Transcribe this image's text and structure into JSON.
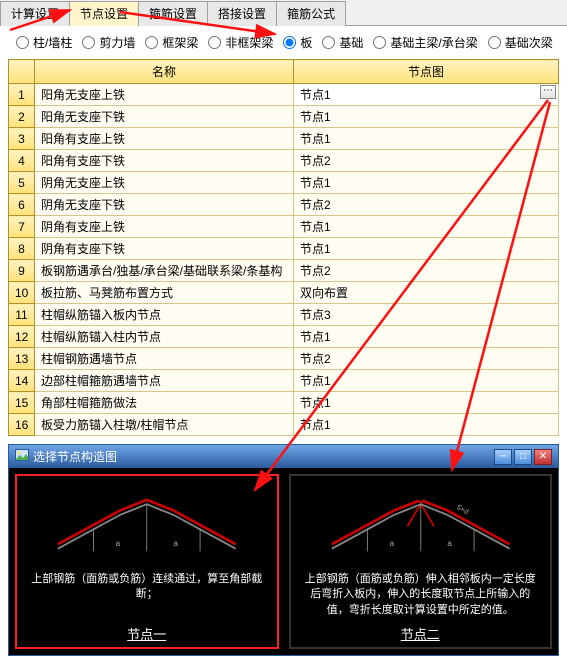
{
  "tabs": {
    "items": [
      "计算设置",
      "节点设置",
      "箍筋设置",
      "搭接设置",
      "箍筋公式"
    ],
    "active_index": 1
  },
  "radios": {
    "items": [
      "柱/墙柱",
      "剪力墙",
      "框架梁",
      "非框架梁",
      "板",
      "基础",
      "基础主梁/承台梁",
      "基础次梁"
    ],
    "selected_index": 4
  },
  "grid": {
    "headers": [
      "名称",
      "节点图"
    ],
    "rows": [
      {
        "n": "1",
        "name": "阳角无支座上铁",
        "val": "节点1"
      },
      {
        "n": "2",
        "name": "阳角无支座下铁",
        "val": "节点1"
      },
      {
        "n": "3",
        "name": "阳角有支座上铁",
        "val": "节点1"
      },
      {
        "n": "4",
        "name": "阳角有支座下铁",
        "val": "节点2"
      },
      {
        "n": "5",
        "name": "阴角无支座上铁",
        "val": "节点1"
      },
      {
        "n": "6",
        "name": "阴角无支座下铁",
        "val": "节点2"
      },
      {
        "n": "7",
        "name": "阴角有支座上铁",
        "val": "节点1"
      },
      {
        "n": "8",
        "name": "阴角有支座下铁",
        "val": "节点1"
      },
      {
        "n": "9",
        "name": "板钢筋遇承台/独基/承台梁/基础联系梁/条基构",
        "val": "节点2"
      },
      {
        "n": "10",
        "name": "板拉筋、马凳筋布置方式",
        "val": "双向布置"
      },
      {
        "n": "11",
        "name": "柱帽纵筋锚入板内节点",
        "val": "节点3"
      },
      {
        "n": "12",
        "name": "柱帽纵筋锚入柱内节点",
        "val": "节点1"
      },
      {
        "n": "13",
        "name": "柱帽钢筋遇墙节点",
        "val": "节点2"
      },
      {
        "n": "14",
        "name": "边部柱帽箍筋遇墙节点",
        "val": "节点1"
      },
      {
        "n": "15",
        "name": "角部柱帽箍筋做法",
        "val": "节点1"
      },
      {
        "n": "16",
        "name": "板受力筋锚入柱墩/柱帽节点",
        "val": "节点1"
      }
    ],
    "selected_row": 0
  },
  "dialog": {
    "title": "选择节点构造图",
    "icon": "picture-icon",
    "thumbs": [
      {
        "desc": "上部钢筋（面筋或负筋）连续通过，算至角部截断；",
        "caption": "节点一"
      },
      {
        "desc": "上部钢筋（面筋或负筋）伸入相邻板内一定长度后弯折入板内，伸入的长度取节点上所输入的值，弯折长度取计算设置中所定的值。",
        "caption": "节点二"
      }
    ],
    "selected_thumb": 0
  }
}
